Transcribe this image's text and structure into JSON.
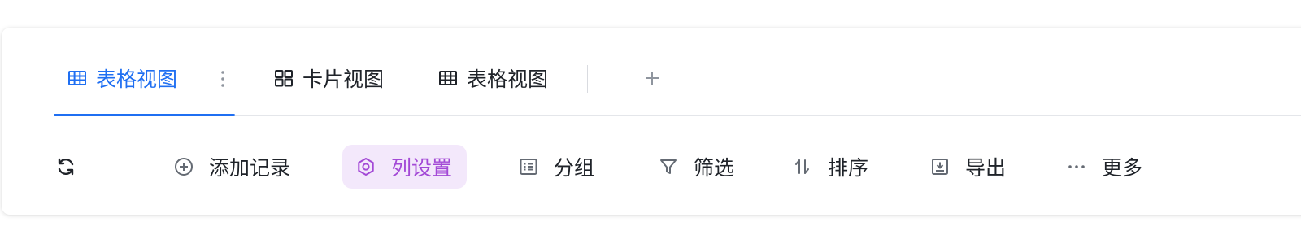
{
  "tabs": [
    {
      "label": "表格视图",
      "icon": "table-grid-icon",
      "active": true
    },
    {
      "label": "卡片视图",
      "icon": "card-grid-icon",
      "active": false
    },
    {
      "label": "表格视图",
      "icon": "table-grid-icon",
      "active": false
    }
  ],
  "tab_actions": {
    "more_icon": "vertical-dots-icon",
    "add_icon": "plus-icon"
  },
  "toolbar": {
    "refresh_icon": "refresh-icon",
    "add_record": "添加记录",
    "column_settings": "列设置",
    "group": "分组",
    "filter": "筛选",
    "sort": "排序",
    "export": "导出",
    "more": "更多"
  },
  "colors": {
    "accent": "#1f6ff2",
    "highlight_bg": "#f3e8fb",
    "highlight_text": "#a349d6",
    "text": "#1f2329",
    "icon": "#646a73"
  }
}
